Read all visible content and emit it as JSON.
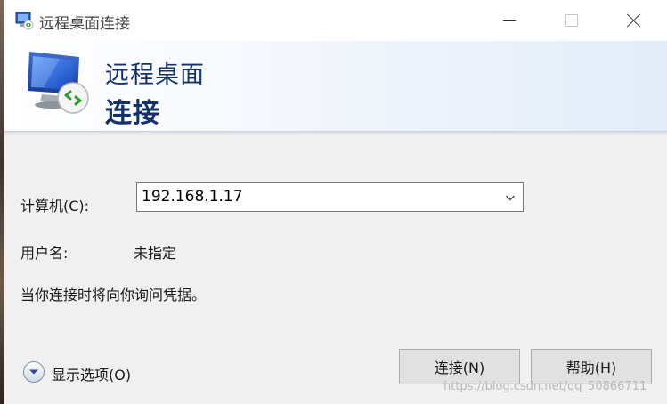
{
  "window": {
    "title": "远程桌面连接"
  },
  "banner": {
    "line1": "远程桌面",
    "line2": "连接"
  },
  "form": {
    "computer_label": "计算机(C):",
    "computer_value": "192.168.1.17",
    "user_label": "用户名:",
    "user_value": "未指定",
    "note": "当你连接时将向你询问凭据。"
  },
  "footer": {
    "options_label": "显示选项(O)",
    "connect_label": "连接(N)",
    "help_label": "帮助(H)"
  },
  "watermark": "https://blog.csdn.net/qq_50866711",
  "colors": {
    "banner_text": "#13326b",
    "button_bg": "#e1e1e1",
    "window_bg": "#f0f0f0"
  }
}
